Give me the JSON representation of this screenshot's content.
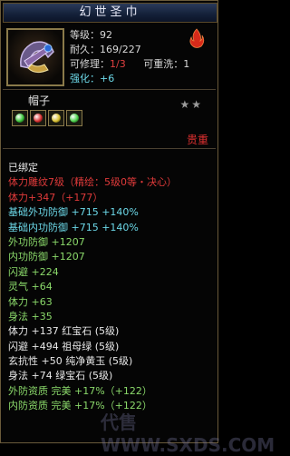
{
  "title": "幻世圣巾",
  "item_icon": "helmet-icon",
  "info": {
    "level_label": "等级：",
    "level_value": "92",
    "durability_label": "耐久：",
    "durability_value": "169/227",
    "repair_label": "可修理：",
    "repair_value": "1/3",
    "rewash_label": "可重洗：",
    "rewash_value": "1",
    "enhance_label": "强化：",
    "enhance_value": "+6"
  },
  "element_icon": "flame-icon",
  "category": "帽子",
  "stars": "★★",
  "gems": [
    {
      "name": "green-gem-icon",
      "color": "#3ac43a"
    },
    {
      "name": "red-gem-icon",
      "color": "#d83030"
    },
    {
      "name": "yellow-gem-icon",
      "color": "#d8c030"
    },
    {
      "name": "green-gem-icon",
      "color": "#4ad04a"
    }
  ],
  "rarity": "贵重",
  "bound": "已绑定",
  "attributes": [
    {
      "text": "体力雕纹7级（精绘：5级0等・决心）",
      "color": "red"
    },
    {
      "text": "体力+347（+177）",
      "color": "red"
    },
    {
      "text": "基础外功防御 +715  +140%",
      "color": "cyan"
    },
    {
      "text": "基础内功防御 +715  +140%",
      "color": "cyan"
    },
    {
      "text": "外功防御 +1207",
      "color": "green"
    },
    {
      "text": "内功防御 +1207",
      "color": "green"
    },
    {
      "text": "闪避 +224",
      "color": "green"
    },
    {
      "text": "灵气 +64",
      "color": "green"
    },
    {
      "text": "体力 +63",
      "color": "green"
    },
    {
      "text": "身法 +35",
      "color": "green"
    },
    {
      "text": "体力 +137 红宝石 (5级)",
      "color": "white"
    },
    {
      "text": "闪避 +494 祖母绿 (5级)",
      "color": "white"
    },
    {
      "text": "玄抗性 +50 纯净黄玉 (5级)",
      "color": "white"
    },
    {
      "text": "身法 +74 绿宝石 (5级)",
      "color": "white"
    },
    {
      "text": "外防资质  完美 +17%（+122）",
      "color": "green"
    },
    {
      "text": "内防资质  完美 +17%（+122）",
      "color": "green"
    }
  ],
  "watermark": "代售 WWW.SXDS.COM"
}
